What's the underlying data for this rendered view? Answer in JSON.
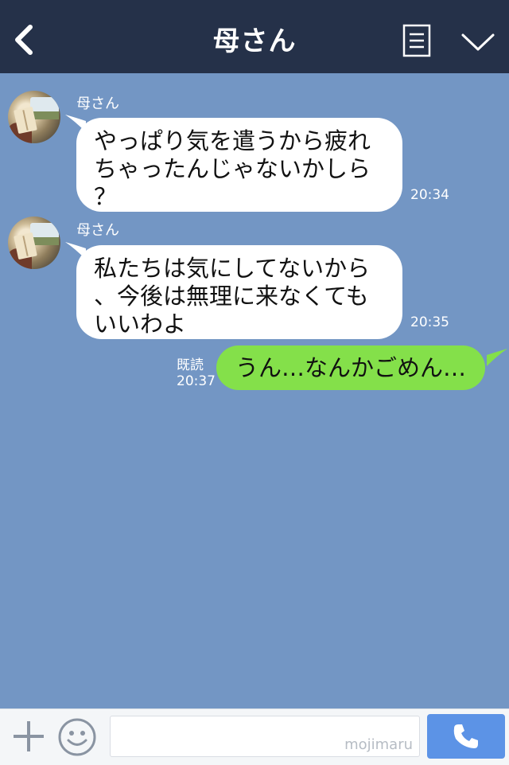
{
  "header": {
    "title": "母さん"
  },
  "messages": [
    {
      "sender": "母さん",
      "lines": [
        "やっぱり気を遣うから疲れ",
        "ちゃったんじゃないかしら",
        "？"
      ],
      "time": "20:34"
    },
    {
      "sender": "母さん",
      "lines": [
        "私たちは気にしてないから",
        "、今後は無理に来なくても",
        "いいわよ"
      ],
      "time": "20:35"
    },
    {
      "outgoing": true,
      "text": "うん…なんかごめん…",
      "read_label": "既読",
      "time": "20:37"
    }
  ],
  "input": {
    "watermark": "mojimaru"
  },
  "colors": {
    "header_bg": "#253149",
    "chat_bg": "#7396c4",
    "outgoing_bubble": "#84e04a",
    "call_button": "#5c93e6"
  },
  "icons": [
    "back-icon",
    "menu-icon",
    "chevron-down-icon",
    "plus-icon",
    "smile-icon",
    "phone-icon"
  ]
}
